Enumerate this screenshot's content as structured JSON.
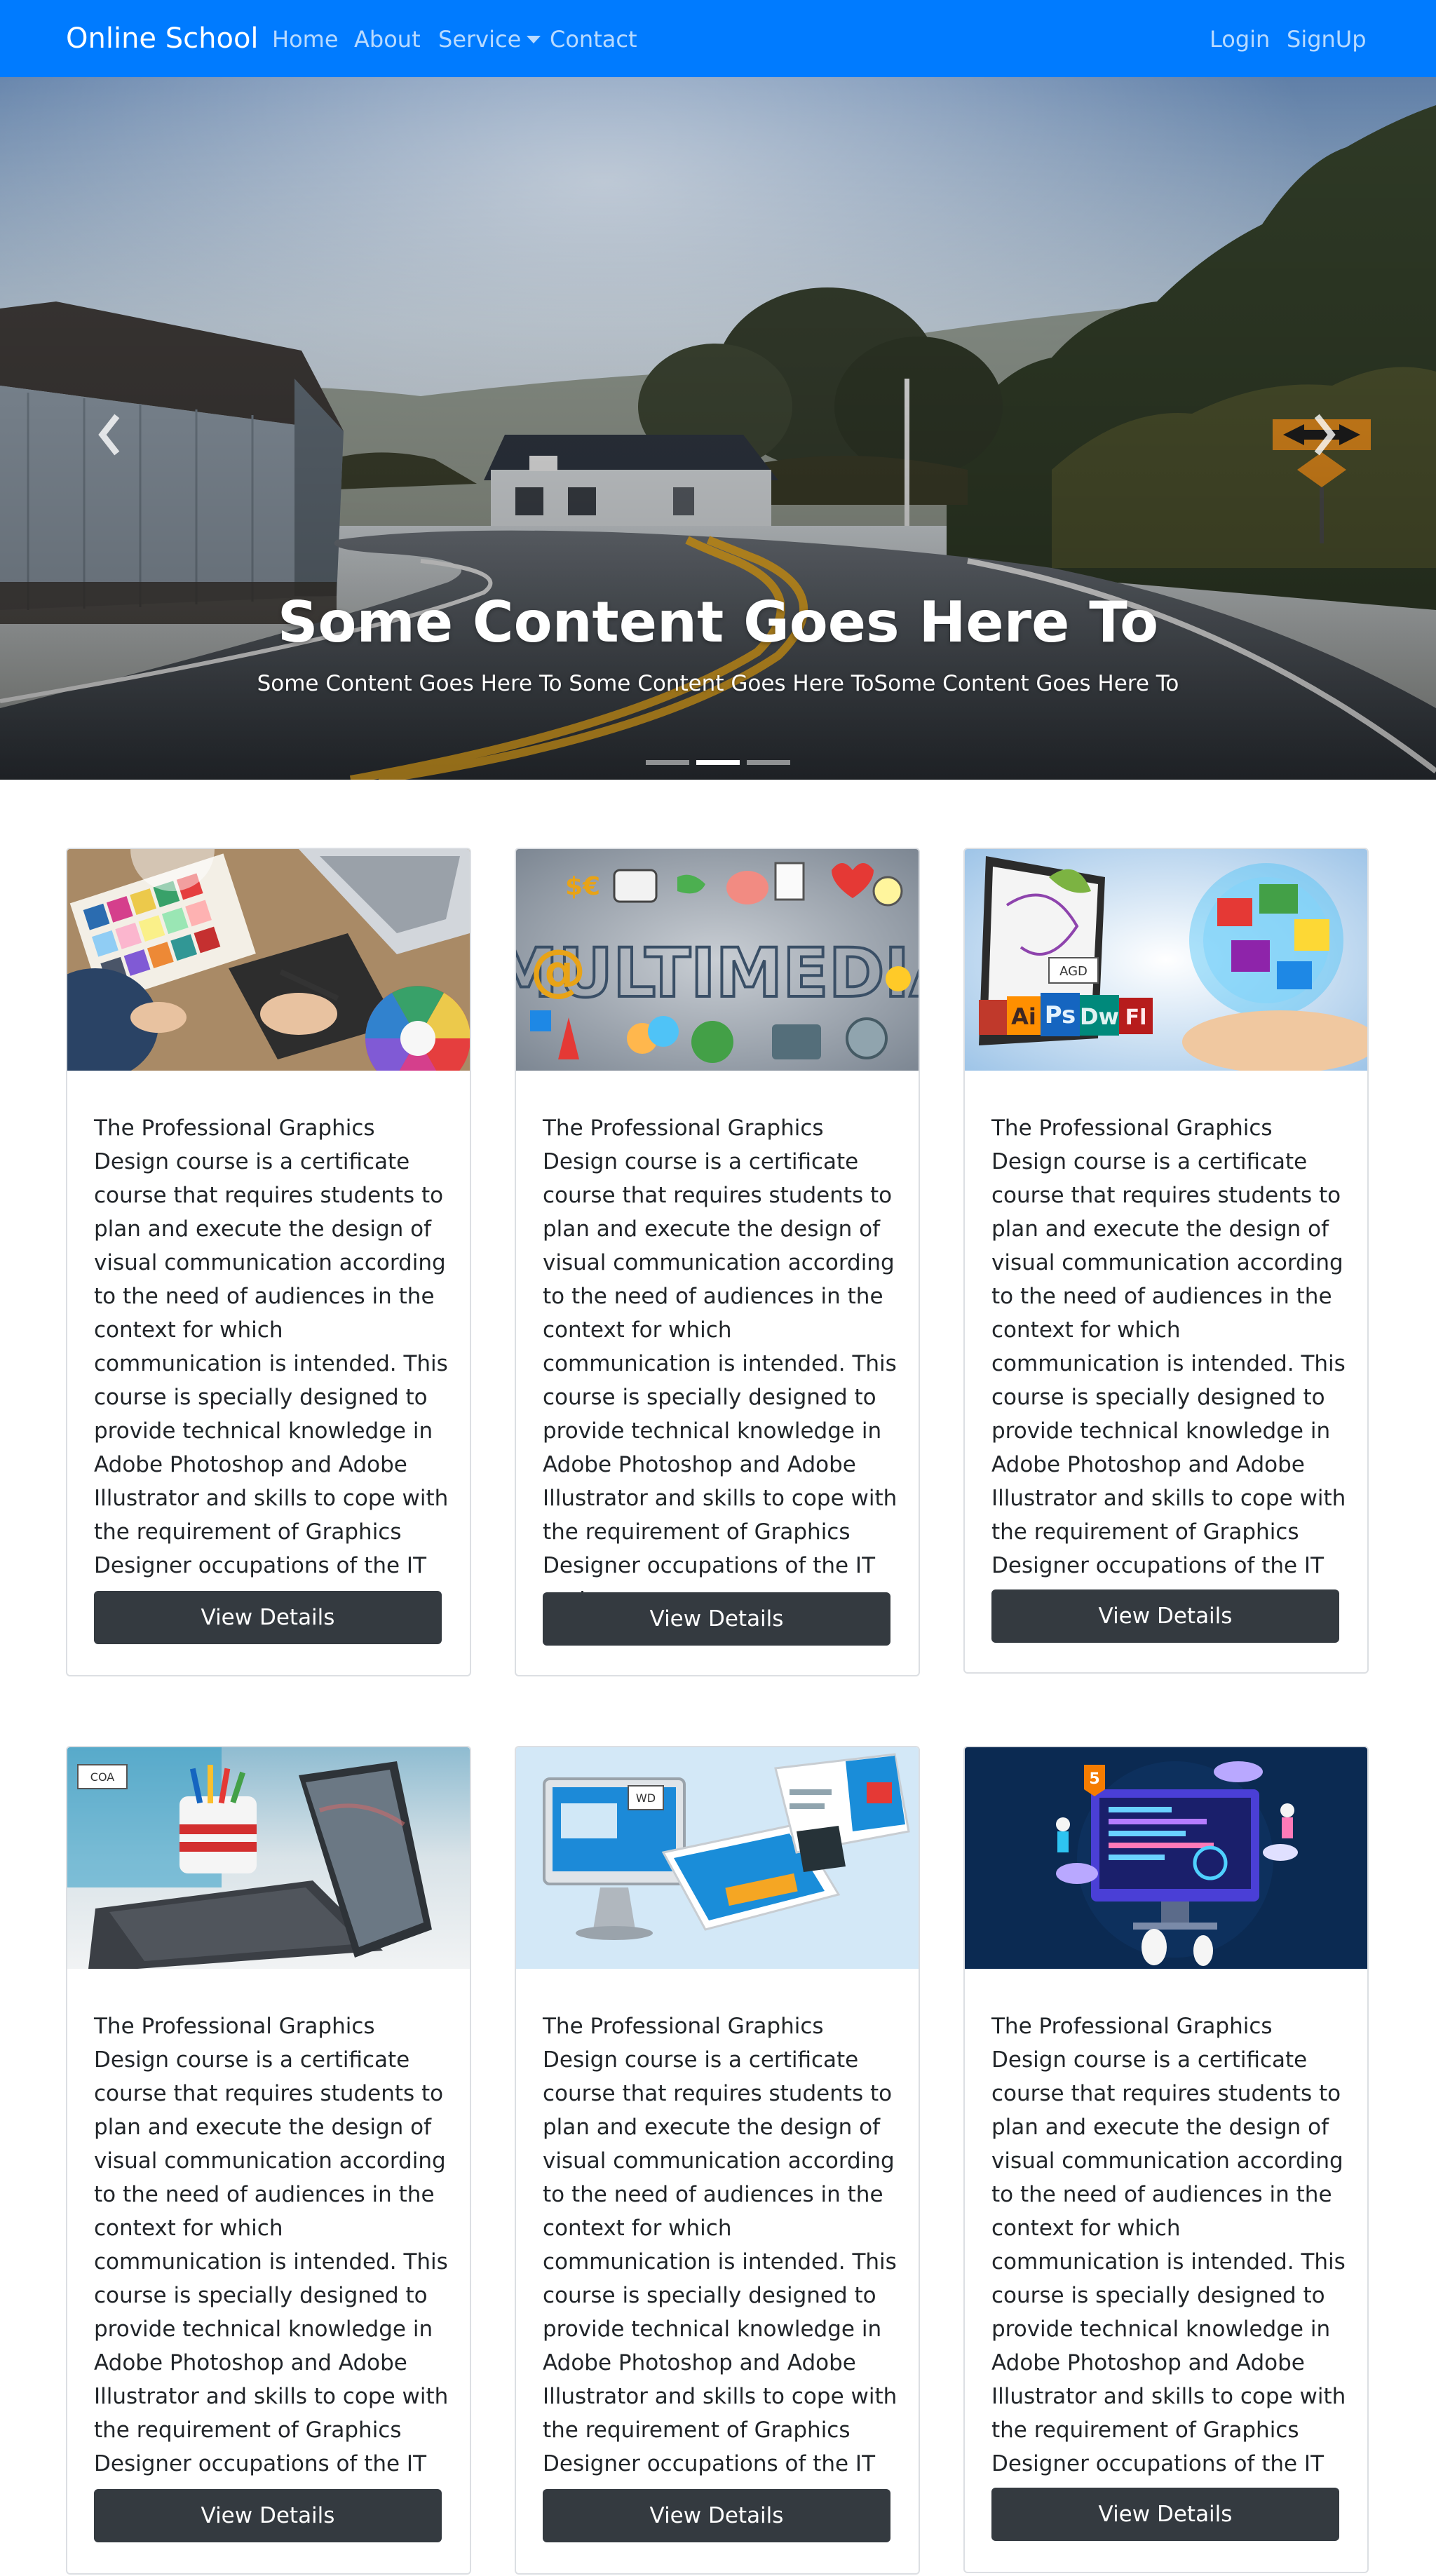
{
  "navbar": {
    "brand": "Online School",
    "links": [
      "Home",
      "About",
      "Service",
      "Contact"
    ],
    "right_links": [
      "Login",
      "SignUp"
    ],
    "bg_color": "#007bff"
  },
  "carousel": {
    "title": "Some Content Goes Here To",
    "text": "Some Content Goes Here To Some Content Goes Here ToSome Content Goes Here To",
    "indicator_count": 3,
    "active_indicator": 2
  },
  "cards": [
    {
      "image": "graphic-design-desk-image",
      "text": "The Professional Graphics Design course is a certificate course that requires students to plan and execute the design of visual communication according to the need of audiences in the context for which communication is intended. This course is specially designed to provide technical knowledge in Adobe Photoshop and Adobe Illustrator and skills to cope with the requirement of Graphics Designer occupations of the IT sector.",
      "button": "View Details"
    },
    {
      "image": "multimedia-image",
      "image_label": "MULTIMEDIA",
      "image_symbols": [
        "$€",
        "@"
      ],
      "text": "The Professional Graphics Design course is a certificate course that requires students to plan and execute the design of visual communication according to the need of audiences in the context for which communication is intended. This course is specially designed to provide technical knowledge in Adobe Photoshop and Adobe Illustrator and skills to cope with the requirement of Graphics Designer occupations of the IT sector.",
      "button": "View Details"
    },
    {
      "image": "adobe-graphics-image",
      "image_tag": "AGD",
      "image_apps": [
        "Ai",
        "Ps",
        "Dw",
        "Fl"
      ],
      "text": "The Professional Graphics Design course is a certificate course that requires students to plan and execute the design of visual communication according to the need of audiences in the context for which communication is intended. This course is specially designed to provide technical knowledge in Adobe Photoshop and Adobe Illustrator and skills to cope with the requirement of Graphics Designer occupations of the IT sector.",
      "button": "View Details"
    },
    {
      "image": "tablet-keyboard-image",
      "image_tag": "COA",
      "text": "The Professional Graphics Design course is a certificate course that requires students to plan and execute the design of visual communication according to the need of audiences in the context for which communication is intended. This course is specially designed to provide technical knowledge in Adobe Photoshop and Adobe Illustrator and skills to cope with the requirement of Graphics Designer occupations of the IT sector.",
      "button": "View Details"
    },
    {
      "image": "web-design-devices-image",
      "image_tag": "WD",
      "text": "The Professional Graphics Design course is a certificate course that requires students to plan and execute the design of visual communication according to the need of audiences in the context for which communication is intended. This course is specially designed to provide technical knowledge in Adobe Photoshop and Adobe Illustrator and skills to cope with the requirement of Graphics Designer occupations of the IT sector.",
      "button": "View Details"
    },
    {
      "image": "web-development-illustration-image",
      "image_badge": "5",
      "text": "The Professional Graphics Design course is a certificate course that requires students to plan and execute the design of visual communication according to the need of audiences in the context for which communication is intended. This course is specially designed to provide technical knowledge in Adobe Photoshop and Adobe Illustrator and skills to cope with the requirement of Graphics Designer occupations of the IT sector.",
      "button": "View Details"
    }
  ]
}
